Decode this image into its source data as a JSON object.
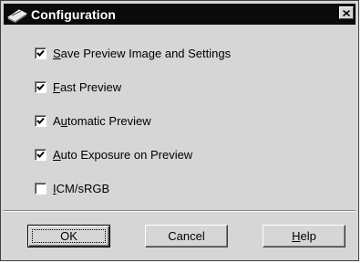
{
  "window": {
    "title": "Configuration",
    "icon": "scanner-icon",
    "close_glyph": "✕"
  },
  "options": [
    {
      "label_prefix": "",
      "mnemonic": "S",
      "label_rest": "ave Preview Image and Settings",
      "checked": true
    },
    {
      "label_prefix": "",
      "mnemonic": "F",
      "label_rest": "ast Preview",
      "checked": true
    },
    {
      "label_prefix": "A",
      "mnemonic": "u",
      "label_rest": "tomatic Preview",
      "checked": true
    },
    {
      "label_prefix": "",
      "mnemonic": "A",
      "label_rest": "uto Exposure on Preview",
      "checked": true
    },
    {
      "label_prefix": "",
      "mnemonic": "I",
      "label_rest": "CM/sRGB",
      "checked": false
    }
  ],
  "buttons": {
    "ok": {
      "label": "OK"
    },
    "cancel": {
      "label": "Cancel"
    },
    "help": {
      "mnemonic": "H",
      "label_rest": "elp"
    }
  }
}
